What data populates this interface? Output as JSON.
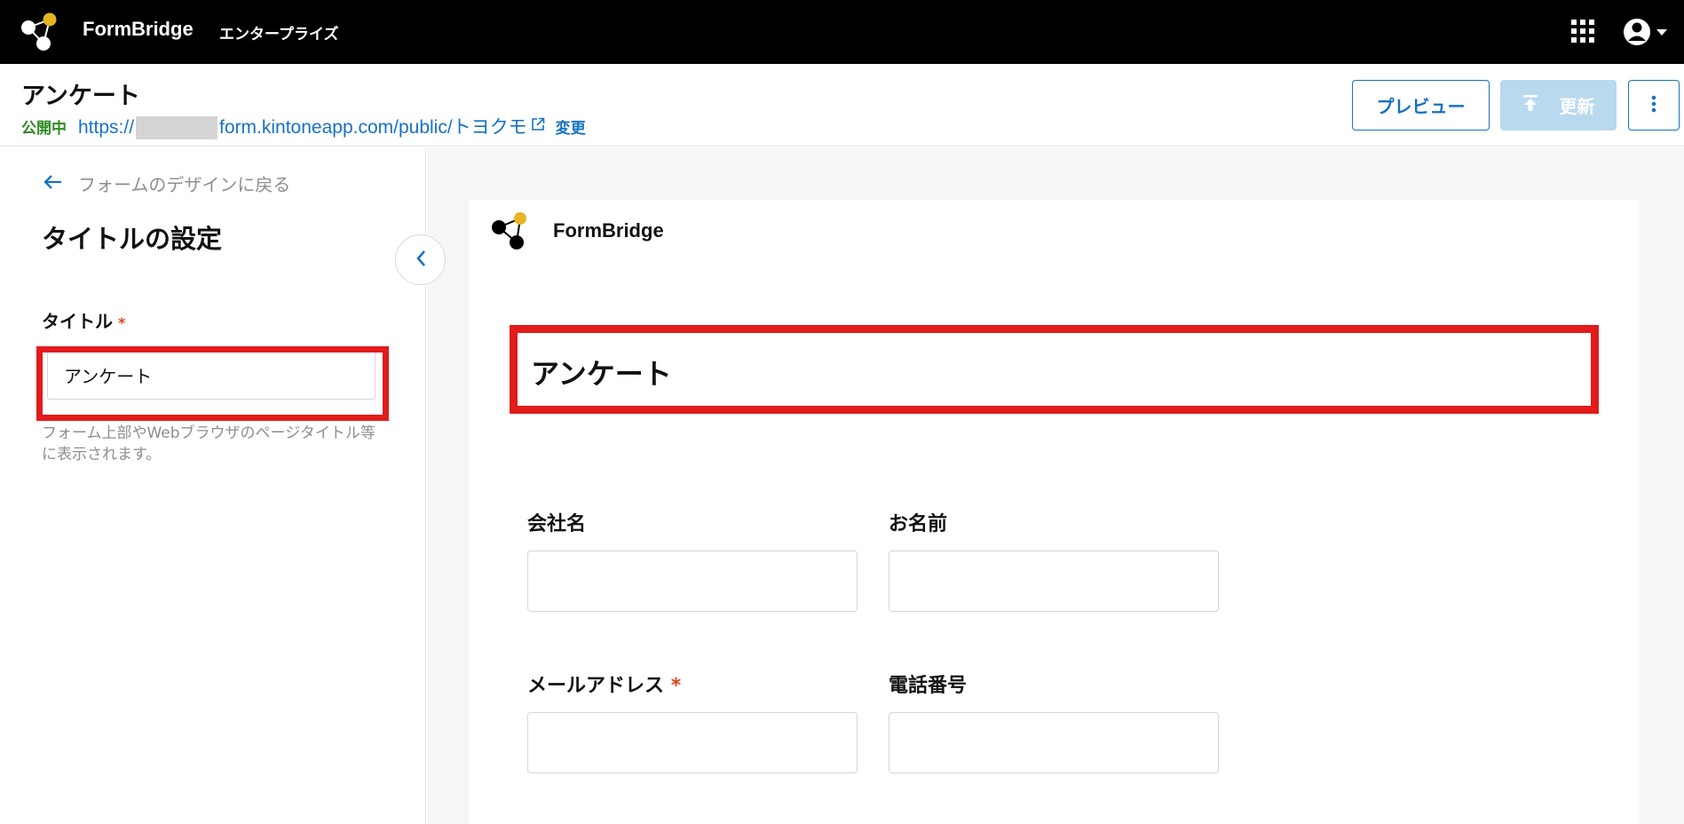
{
  "app": {
    "brand": "FormBridge",
    "edition": "エンタープライズ"
  },
  "header": {
    "title": "アンケート",
    "status": "公開中",
    "url_prefix": "https://",
    "url_suffix": "form.kintoneapp.com/public/トヨクモ",
    "change_label": "変更",
    "preview_label": "プレビュー",
    "update_label": "更新"
  },
  "sidebar": {
    "back_label": "フォームのデザインに戻る",
    "section_title": "タイトルの設定",
    "field_label": "タイトル",
    "required_mark": "*",
    "title_value": "アンケート",
    "help_text": "フォーム上部やWebブラウザのページタイトル等に表示されます。"
  },
  "preview": {
    "brand": "FormBridge",
    "form_title": "アンケート",
    "fields": [
      {
        "label": "会社名",
        "required": false
      },
      {
        "label": "お名前",
        "required": false
      },
      {
        "label": "メールアドレス",
        "required": true,
        "required_mark": "*"
      },
      {
        "label": "電話番号",
        "required": false
      }
    ]
  },
  "colors": {
    "accent": "#1672c4",
    "status_green": "#2e8b21",
    "highlight_red": "#e21b1b",
    "logo_gold": "#e6b422"
  },
  "icons": [
    "formbridge-logo-icon",
    "apps-grid-icon",
    "account-icon",
    "external-link-icon",
    "upload-icon",
    "more-vertical-icon",
    "arrow-left-icon",
    "chevron-left-icon"
  ]
}
